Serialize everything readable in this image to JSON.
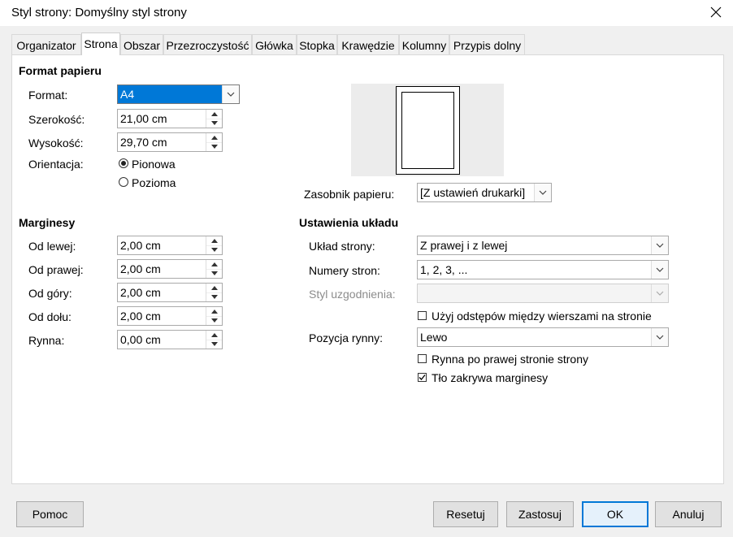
{
  "window": {
    "title": "Styl strony: Domyślny styl strony"
  },
  "tabs": [
    "Organizator",
    "Strona",
    "Obszar",
    "Przezroczystość",
    "Główka",
    "Stopka",
    "Krawędzie",
    "Kolumny",
    "Przypis dolny"
  ],
  "active_tab": "Strona",
  "paper_format": {
    "heading": "Format papieru",
    "format_label": "Format:",
    "format_value": "A4",
    "width_label": "Szerokość:",
    "width_value": "21,00 cm",
    "height_label": "Wysokość:",
    "height_value": "29,70 cm",
    "orientation_label": "Orientacja:",
    "portrait_label": "Pionowa",
    "landscape_label": "Pozioma",
    "orientation_selected": "Pionowa",
    "tray_label": "Zasobnik papieru:",
    "tray_value": "[Z ustawień drukarki]"
  },
  "margins": {
    "heading": "Marginesy",
    "left_label": "Od lewej:",
    "left_value": "2,00 cm",
    "right_label": "Od prawej:",
    "right_value": "2,00 cm",
    "top_label": "Od góry:",
    "top_value": "2,00 cm",
    "bottom_label": "Od dołu:",
    "bottom_value": "2,00 cm",
    "gutter_label": "Rynna:",
    "gutter_value": "0,00 cm"
  },
  "layout": {
    "heading": "Ustawienia układu",
    "page_layout_label": "Układ strony:",
    "page_layout_value": "Z prawej i z lewej",
    "page_numbers_label": "Numery stron:",
    "page_numbers_value": "1, 2, 3, ...",
    "reference_style_label": "Styl uzgodnienia:",
    "reference_style_value": "",
    "use_spacing_label": "Użyj odstępów między wierszami na stronie",
    "use_spacing_checked": false,
    "gutter_position_label": "Pozycja rynny:",
    "gutter_position_value": "Lewo",
    "gutter_right_label": "Rynna po prawej stronie strony",
    "gutter_right_checked": false,
    "bg_covers_margins_label": "Tło zakrywa marginesy",
    "bg_covers_margins_checked": true
  },
  "buttons": {
    "help": "Pomoc",
    "reset": "Resetuj",
    "apply": "Zastosuj",
    "ok": "OK",
    "cancel": "Anuluj"
  },
  "colors": {
    "selection": "#0078d7",
    "default_button_border": "#0078d7"
  }
}
